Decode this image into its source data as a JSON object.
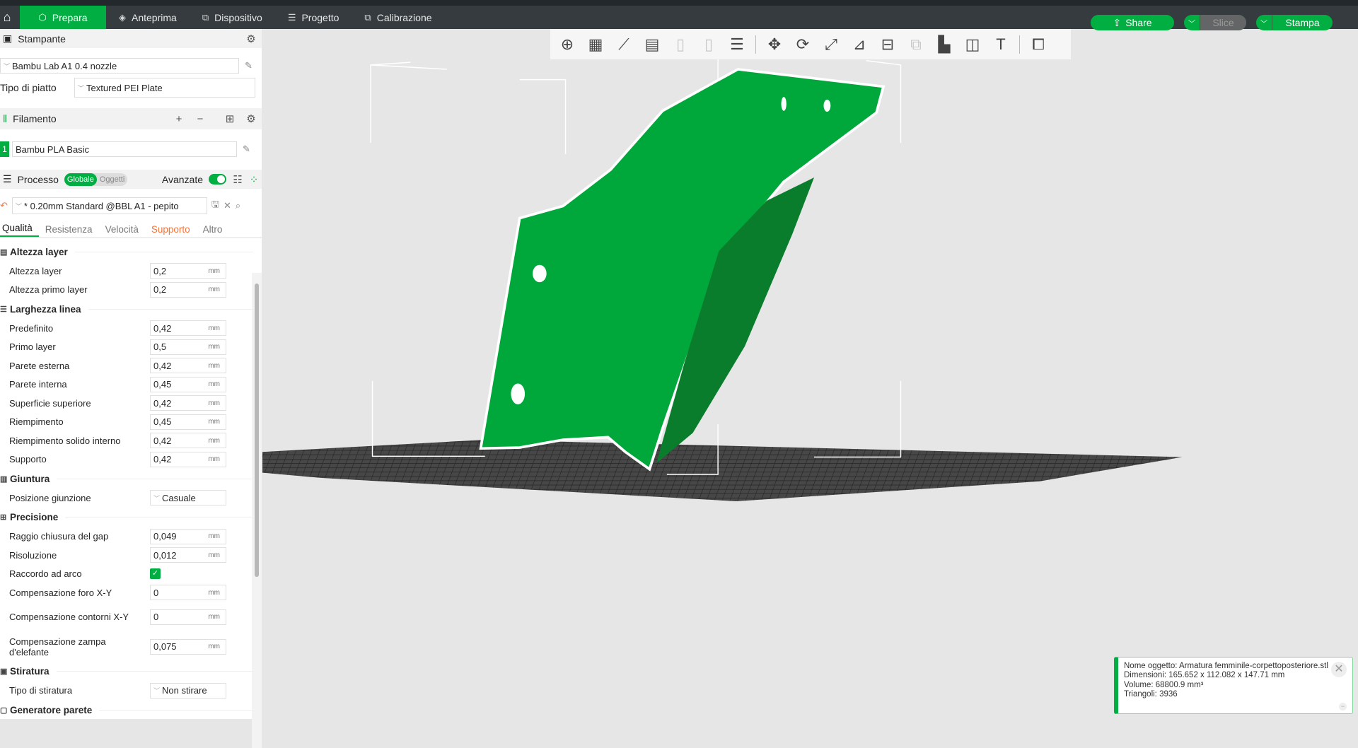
{
  "nav": {
    "tabs": [
      {
        "label": "Prepara",
        "icon": "cube-icon"
      },
      {
        "label": "Anteprima",
        "icon": "layers-icon"
      },
      {
        "label": "Dispositivo",
        "icon": "device-icon"
      },
      {
        "label": "Progetto",
        "icon": "list-icon"
      },
      {
        "label": "Calibrazione",
        "icon": "calibration-icon"
      }
    ],
    "share": "Share",
    "slice": "Slice",
    "print": "Stampa"
  },
  "printer": {
    "title": "Stampante",
    "name": "Bambu Lab A1 0.4 nozzle",
    "plate_label": "Tipo di piatto",
    "plate": "Textured PEI Plate"
  },
  "filament": {
    "title": "Filamento",
    "slot": "1",
    "name": "Bambu PLA Basic"
  },
  "process": {
    "title": "Processo",
    "global": "Globale",
    "objects": "Oggetti",
    "advanced": "Avanzate",
    "advanced_on": true,
    "preset": "* 0.20mm Standard @BBL A1 - pepito"
  },
  "tabs": [
    "Qualità",
    "Resistenza",
    "Velocità",
    "Supporto",
    "Altro"
  ],
  "groups": [
    {
      "title": "Altezza layer",
      "rows": [
        {
          "label": "Altezza layer",
          "value": "0,2",
          "unit": "mm"
        },
        {
          "label": "Altezza primo layer",
          "value": "0,2",
          "unit": "mm"
        }
      ]
    },
    {
      "title": "Larghezza linea",
      "rows": [
        {
          "label": "Predefinito",
          "value": "0,42",
          "unit": "mm"
        },
        {
          "label": "Primo layer",
          "value": "0,5",
          "unit": "mm"
        },
        {
          "label": "Parete esterna",
          "value": "0,42",
          "unit": "mm"
        },
        {
          "label": "Parete interna",
          "value": "0,45",
          "unit": "mm"
        },
        {
          "label": "Superficie superiore",
          "value": "0,42",
          "unit": "mm"
        },
        {
          "label": "Riempimento",
          "value": "0,45",
          "unit": "mm"
        },
        {
          "label": "Riempimento solido interno",
          "value": "0,42",
          "unit": "mm"
        },
        {
          "label": "Supporto",
          "value": "0,42",
          "unit": "mm"
        }
      ]
    },
    {
      "title": "Giuntura",
      "rows": [
        {
          "label": "Posizione giunzione",
          "select": "Casuale"
        }
      ]
    },
    {
      "title": "Precisione",
      "rows": [
        {
          "label": "Raggio chiusura del gap",
          "value": "0,049",
          "unit": "mm"
        },
        {
          "label": "Risoluzione",
          "value": "0,012",
          "unit": "mm"
        },
        {
          "label": "Raccordo ad arco",
          "checked": true
        },
        {
          "label": "Compensazione foro X-Y",
          "value": "0",
          "unit": "mm"
        },
        {
          "label": "Compensazione contorni X-Y",
          "value": "0",
          "unit": "mm",
          "tall": true
        },
        {
          "label": "Compensazione zampa d'elefante",
          "value": "0,075",
          "unit": "mm",
          "tall": true
        }
      ]
    },
    {
      "title": "Stiratura",
      "rows": [
        {
          "label": "Tipo di stiratura",
          "select": "Non stirare"
        }
      ]
    },
    {
      "title": "Generatore parete",
      "rows": []
    }
  ],
  "toolbar": [
    {
      "icon": "add-object-icon"
    },
    {
      "icon": "add-plate-icon"
    },
    {
      "icon": "auto-orient-icon"
    },
    {
      "icon": "arrange-icon"
    },
    {
      "icon": "plate-o-icon",
      "disabled": true
    },
    {
      "icon": "plate-p-icon",
      "disabled": true
    },
    {
      "icon": "layers-menu-icon",
      "sep": true
    },
    {
      "icon": "move-icon"
    },
    {
      "icon": "rotate-icon"
    },
    {
      "icon": "scale-icon"
    },
    {
      "icon": "lay-on-face-icon"
    },
    {
      "icon": "cut-icon"
    },
    {
      "icon": "boolean-icon",
      "disabled": true
    },
    {
      "icon": "support-paint-icon"
    },
    {
      "icon": "seam-paint-icon"
    },
    {
      "icon": "text-icon",
      "sep": true
    },
    {
      "icon": "assembly-icon"
    }
  ],
  "notification": {
    "lines": [
      "Nome oggetto: Armatura femminile-corpettoposteriore.stl",
      "Dimensioni: 165.652 x 112.082 x 147.71 mm",
      "Volume: 68800.9 mm³",
      "Triangoli: 3936"
    ]
  },
  "colors": {
    "accent": "#00ae42",
    "model": "#00a83b",
    "nav": "#353b3e",
    "warning": "#f5743b"
  }
}
